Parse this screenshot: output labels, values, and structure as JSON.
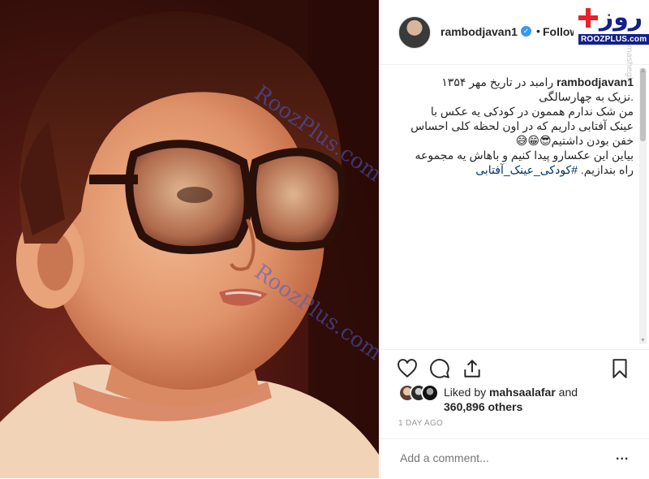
{
  "header": {
    "username": "rambodjavan1",
    "verified_glyph": "✓",
    "separator": "•",
    "follow_status": "Following"
  },
  "logo": {
    "text": "روز",
    "site": "ROOZPLUS.com",
    "side_watermark": "mashegh"
  },
  "photo": {
    "watermark_1": "RoozPlus.com",
    "watermark_2": "RoozPlus.com"
  },
  "caption": {
    "user": "rambodjavan1",
    "line1": " رامبد در تاریخ مهر ۱۳۵۴",
    "line2": ".نزیک به چهارسالگی",
    "line3": "من شک ندارم هممون در کودکی یه عکس با",
    "line4": "عینک آفتابی داریم که در اون لحظه کلی احساس",
    "line5": "خفن بودن داشتیم😎😁😅",
    "line6": "بیاین این عکسارو پیدا کنیم و باهاش یه مجموعه",
    "line7_text": "راه بندازیم. ",
    "line7_tag": "#کودکی_عینک_آفتابی"
  },
  "likes": {
    "prefix": "Liked by ",
    "user": "mahsaalafar",
    "and": " and",
    "count": "360,896 others"
  },
  "time_ago": "1 DAY AGO",
  "comment": {
    "placeholder": "Add a comment...",
    "more": "..."
  },
  "icons": [
    "heart-icon",
    "comment-icon",
    "share-icon",
    "bookmark-icon",
    "verified-badge-icon"
  ],
  "colors": {
    "link": "#003569",
    "verified": "#3897f0",
    "logo_blue": "#13208a",
    "logo_red": "#e8212a"
  }
}
